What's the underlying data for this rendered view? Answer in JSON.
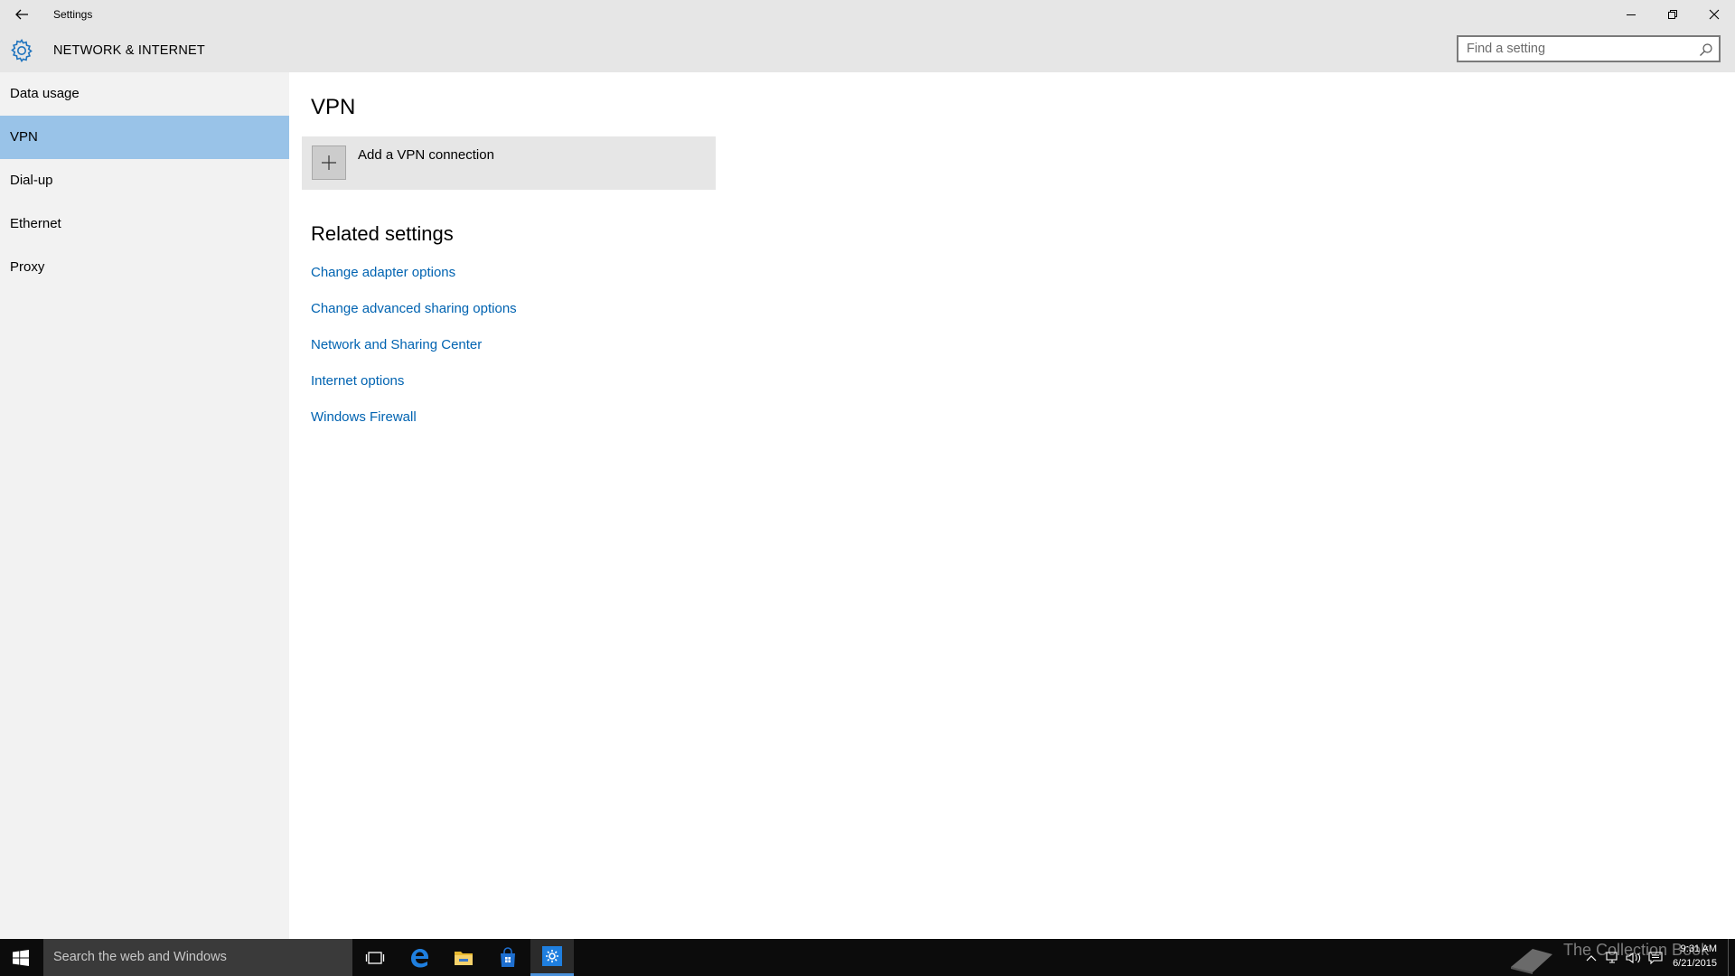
{
  "window": {
    "title": "Settings",
    "section_title": "NETWORK & INTERNET"
  },
  "search": {
    "placeholder": "Find a setting",
    "value": ""
  },
  "sidebar": {
    "items": [
      {
        "label": "Data usage",
        "selected": false
      },
      {
        "label": "VPN",
        "selected": true
      },
      {
        "label": "Dial-up",
        "selected": false
      },
      {
        "label": "Ethernet",
        "selected": false
      },
      {
        "label": "Proxy",
        "selected": false
      }
    ]
  },
  "main": {
    "heading": "VPN",
    "add_vpn_label": "Add a VPN connection",
    "related_heading": "Related settings",
    "links": [
      "Change adapter options",
      "Change advanced sharing options",
      "Network and Sharing Center",
      "Internet options",
      "Windows Firewall"
    ]
  },
  "taskbar": {
    "search_placeholder": "Search the web and Windows",
    "pinned_icons": [
      "task-view-icon",
      "edge-icon",
      "file-explorer-icon",
      "store-icon",
      "settings-icon"
    ],
    "active_app": "settings-icon",
    "tray_icons": [
      "chevron-up-icon",
      "network-icon",
      "volume-icon",
      "action-center-icon"
    ],
    "time": "9:31 AM",
    "date": "6/21/2015",
    "watermark": "The Collection Book"
  },
  "colors": {
    "accent": "#0078d7",
    "selected_nav": "#99c3e8",
    "link": "#0063b1",
    "chrome": "#e6e6e6",
    "sidebar": "#f2f2f2",
    "taskbar": "#0c0c0c"
  }
}
